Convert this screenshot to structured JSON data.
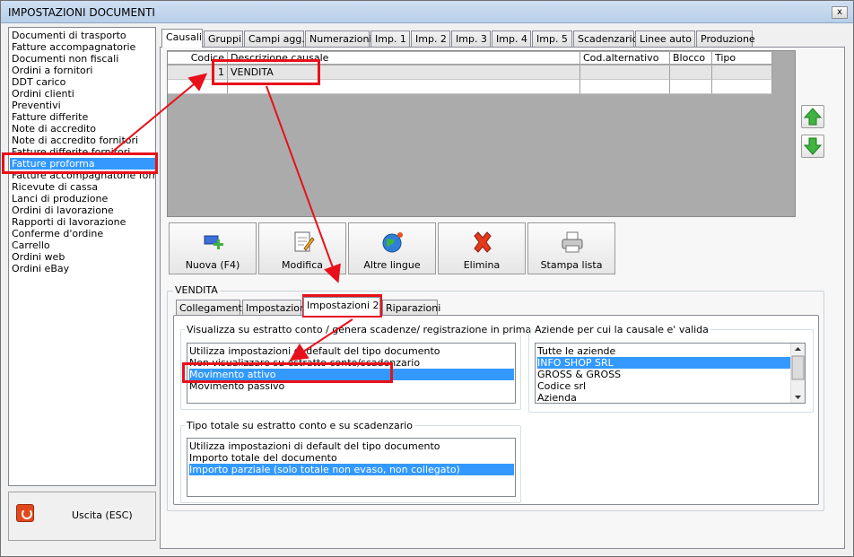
{
  "window": {
    "title": "IMPOSTAZIONI DOCUMENTI",
    "close": "x"
  },
  "sidebar": {
    "items": [
      "Documenti di trasporto",
      "Fatture accompagnatorie",
      "Documenti non fiscali",
      "Ordini a fornitori",
      "DDT carico",
      "Ordini clienti",
      "Preventivi",
      "Fatture differite",
      "Note di accredito",
      "Note di accredito fornitori",
      "Fatture differite fornitori",
      "Fatture proforma",
      "Fatture accompagnatorie fornito",
      "Ricevute di cassa",
      "Lanci di produzione",
      "Ordini di lavorazione",
      "Rapporti di lavorazione",
      "Conferme d'ordine",
      "Carrello",
      "Ordini web",
      "Ordini eBay"
    ],
    "selected_index": 11
  },
  "exit": {
    "label": "Uscita (ESC)"
  },
  "tabs": [
    "Causali",
    "Gruppi",
    "Campi agg.",
    "Numerazioni",
    "Imp. 1",
    "Imp. 2",
    "Imp. 3",
    "Imp. 4",
    "Imp. 5",
    "Scadenzario",
    "Linee auto",
    "Produzione"
  ],
  "grid": {
    "columns": [
      "Codice",
      "Descrizione causale",
      "Cod.alternativo",
      "Blocco",
      "Tipo"
    ],
    "rows": [
      {
        "codice": "1",
        "descrizione": "VENDITA"
      }
    ]
  },
  "toolbar": {
    "nuova": "Nuova (F4)",
    "modifica": "Modifica",
    "lingue": "Altre lingue",
    "elimina": "Elimina",
    "stampa": "Stampa lista"
  },
  "detail": {
    "title": "VENDITA",
    "tabs": [
      "Collegamenti",
      "Impostazioni",
      "Impostazioni 2",
      "Riparazioni"
    ],
    "group1": {
      "label": "Visualizza su estratto conto / genera scadenze/ registrazione  in prima nota",
      "options": [
        "Utilizza impostazioni di default del tipo documento",
        "Non visualizzare su estratto conto/scadenzario",
        "Movimento attivo",
        "Movimento passivo"
      ],
      "selected": 2
    },
    "group2": {
      "label": "Aziende per cui la causale e' valida",
      "options": [
        "Tutte le aziende",
        "INFO SHOP SRL",
        "GROSS & GROSS",
        "Codice srl",
        "Azienda"
      ],
      "selected": 1
    },
    "group3": {
      "label": "Tipo totale su estratto conto e su scadenzario",
      "options": [
        "Utilizza impostazioni di default del tipo documento",
        "Importo totale del documento",
        "Importo parziale (solo totale non evaso, non collegato)"
      ],
      "selected": 2
    }
  },
  "colors": {
    "selection": "#3399ff",
    "annotation": "#e8101a"
  }
}
